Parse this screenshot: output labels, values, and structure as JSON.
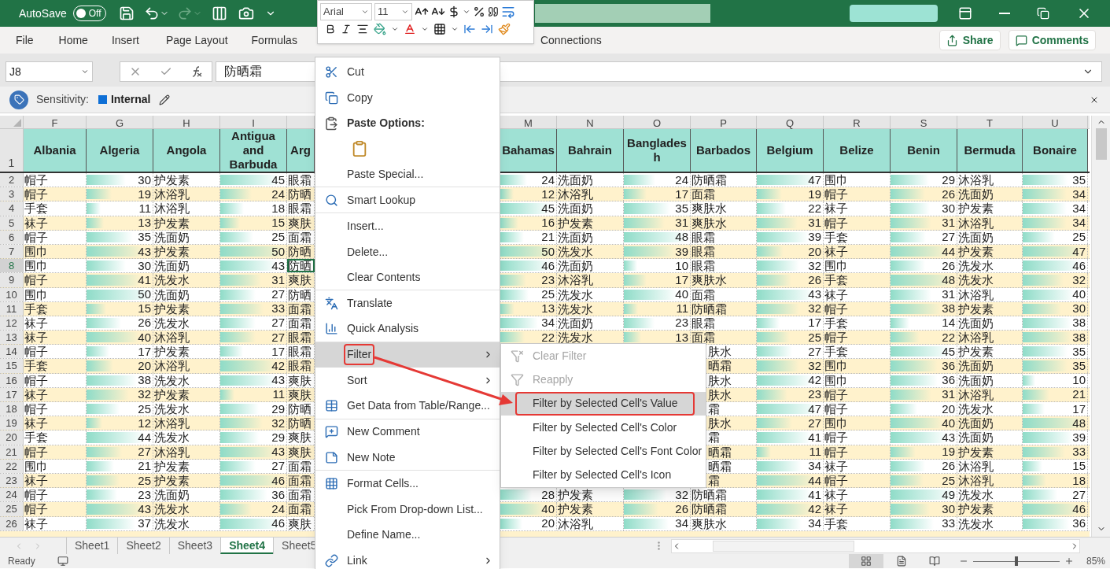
{
  "title_bar": {
    "autosave_label": "AutoSave",
    "autosave": {
      "on": false,
      "label": "Off"
    }
  },
  "mini_toolbar": {
    "font": "Arial",
    "size": "11"
  },
  "ribbon_tabs": [
    {
      "label": "File"
    },
    {
      "label": "Home"
    },
    {
      "label": "Insert"
    },
    {
      "label": "Page Layout"
    },
    {
      "label": "Formulas"
    },
    {
      "label": "Connections"
    }
  ],
  "share": "Share",
  "comments": "Comments",
  "formula_bar": {
    "name_box": "J8",
    "value": "防晒霜"
  },
  "sensitivity": {
    "label": "Sensitivity:",
    "value": "Internal"
  },
  "grid": {
    "header_row": "1",
    "left_columns": [
      {
        "letter": "F",
        "header": "Albania"
      },
      {
        "letter": "G",
        "header": "Algeria"
      },
      {
        "letter": "H",
        "header": "Angola"
      },
      {
        "letter": "I",
        "header": "Antigua and Barbuda"
      },
      {
        "header": "Arg"
      }
    ],
    "right_columns": [
      {
        "letter": "M",
        "header": "Bahamas"
      },
      {
        "letter": "N",
        "header": "Bahrain"
      },
      {
        "letter": "O",
        "header": "Bangladesh"
      },
      {
        "letter": "P",
        "header": "Barbados"
      },
      {
        "letter": "Q",
        "header": "Belgium"
      },
      {
        "letter": "R",
        "header": "Belize"
      },
      {
        "letter": "S",
        "header": "Benin"
      },
      {
        "letter": "T",
        "header": "Bermuda"
      },
      {
        "letter": "U",
        "header": "Bonaire"
      }
    ],
    "rows": [
      {
        "num": "2",
        "selected": false,
        "left": [
          "帽子",
          {
            "v": "30",
            "level": 0.6
          },
          "护发素",
          {
            "v": "45",
            "level": 0.9
          },
          "眼霜"
        ],
        "right": [
          {
            "v": "24",
            "level": 0.48
          },
          "洗面奶",
          {
            "v": "24",
            "level": 0.48
          },
          "防晒霜",
          {
            "v": "47",
            "level": 0.94
          },
          "围巾",
          {
            "v": "29",
            "level": 0.58
          },
          "沐浴乳",
          {
            "v": "35",
            "level": 0.7
          }
        ]
      },
      {
        "num": "3",
        "selected": false,
        "left": [
          "帽子",
          {
            "v": "19",
            "level": 0.38
          },
          "沐浴乳",
          {
            "v": "24",
            "level": 0.48
          },
          "防晒"
        ],
        "right": [
          {
            "v": "12",
            "level": 0.24
          },
          "沐浴乳",
          {
            "v": "17",
            "level": 0.34
          },
          "面霜",
          {
            "v": "19",
            "level": 0.38
          },
          "帽子",
          {
            "v": "26",
            "level": 0.52
          },
          "洗面奶",
          {
            "v": "34",
            "level": 0.68
          }
        ]
      },
      {
        "num": "4",
        "selected": false,
        "left": [
          "手套",
          {
            "v": "11",
            "level": 0.22
          },
          "沐浴乳",
          {
            "v": "18",
            "level": 0.36
          },
          "眼霜"
        ],
        "right": [
          {
            "v": "45",
            "level": 0.9
          },
          "洗面奶",
          {
            "v": "35",
            "level": 0.7
          },
          "爽肤水",
          {
            "v": "22",
            "level": 0.44
          },
          "袜子",
          {
            "v": "30",
            "level": 0.6
          },
          "护发素",
          {
            "v": "34",
            "level": 0.68
          }
        ]
      },
      {
        "num": "5",
        "selected": false,
        "left": [
          "袜子",
          {
            "v": "13",
            "level": 0.26
          },
          "护发素",
          {
            "v": "15",
            "level": 0.3
          },
          "爽肤"
        ],
        "right": [
          {
            "v": "16",
            "level": 0.32
          },
          "护发素",
          {
            "v": "31",
            "level": 0.62
          },
          "爽肤水",
          {
            "v": "31",
            "level": 0.62
          },
          "帽子",
          {
            "v": "31",
            "level": 0.62
          },
          "沐浴乳",
          {
            "v": "34",
            "level": 0.68
          }
        ]
      },
      {
        "num": "6",
        "selected": false,
        "left": [
          "帽子",
          {
            "v": "35",
            "level": 0.7
          },
          "洗面奶",
          {
            "v": "25",
            "level": 0.5
          },
          "面霜"
        ],
        "right": [
          {
            "v": "21",
            "level": 0.42
          },
          "洗面奶",
          {
            "v": "48",
            "level": 0.96
          },
          "眼霜",
          {
            "v": "39",
            "level": 0.78
          },
          "手套",
          {
            "v": "27",
            "level": 0.54
          },
          "洗面奶",
          {
            "v": "25",
            "level": 0.5
          }
        ]
      },
      {
        "num": "7",
        "selected": false,
        "left": [
          "围巾",
          {
            "v": "43",
            "level": 0.86
          },
          "护发素",
          {
            "v": "50",
            "level": 1
          },
          "防晒"
        ],
        "right": [
          {
            "v": "50",
            "level": 1
          },
          "洗发水",
          {
            "v": "39",
            "level": 0.78
          },
          "眼霜",
          {
            "v": "20",
            "level": 0.4
          },
          "袜子",
          {
            "v": "44",
            "level": 0.88
          },
          "护发素",
          {
            "v": "47",
            "level": 0.94
          }
        ]
      },
      {
        "num": "8",
        "selected": true,
        "left": [
          "围巾",
          {
            "v": "30",
            "level": 0.6
          },
          "洗面奶",
          {
            "v": "43",
            "level": 0.86
          },
          "防晒"
        ],
        "right": [
          {
            "v": "46",
            "level": 0.92
          },
          "洗面奶",
          {
            "v": "10",
            "level": 0.2
          },
          "眼霜",
          {
            "v": "32",
            "level": 0.64
          },
          "围巾",
          {
            "v": "26",
            "level": 0.52
          },
          "洗发水",
          {
            "v": "46",
            "level": 0.92
          }
        ]
      },
      {
        "num": "9",
        "selected": false,
        "left": [
          "帽子",
          {
            "v": "41",
            "level": 0.82
          },
          "洗发水",
          {
            "v": "31",
            "level": 0.62
          },
          "爽肤"
        ],
        "right": [
          {
            "v": "23",
            "level": 0.46
          },
          "沐浴乳",
          {
            "v": "17",
            "level": 0.34
          },
          "爽肤水",
          {
            "v": "26",
            "level": 0.52
          },
          "手套",
          {
            "v": "48",
            "level": 0.96
          },
          "洗发水",
          {
            "v": "32",
            "level": 0.64
          }
        ]
      },
      {
        "num": "10",
        "selected": false,
        "left": [
          "围巾",
          {
            "v": "50",
            "level": 1
          },
          "洗面奶",
          {
            "v": "27",
            "level": 0.54
          },
          "防晒"
        ],
        "right": [
          {
            "v": "25",
            "level": 0.5
          },
          "洗发水",
          {
            "v": "40",
            "level": 0.8
          },
          "面霜",
          {
            "v": "43",
            "level": 0.86
          },
          "袜子",
          {
            "v": "31",
            "level": 0.62
          },
          "沐浴乳",
          {
            "v": "40",
            "level": 0.8
          }
        ]
      },
      {
        "num": "11",
        "selected": false,
        "left": [
          "手套",
          {
            "v": "15",
            "level": 0.3
          },
          "护发素",
          {
            "v": "33",
            "level": 0.66
          },
          "面霜"
        ],
        "right": [
          {
            "v": "13",
            "level": 0.26
          },
          "洗发水",
          {
            "v": "11",
            "level": 0.22
          },
          "防晒霜",
          {
            "v": "32",
            "level": 0.64
          },
          "帽子",
          {
            "v": "38",
            "level": 0.76
          },
          "护发素",
          {
            "v": "30",
            "level": 0.6
          }
        ]
      },
      {
        "num": "12",
        "selected": false,
        "left": [
          "袜子",
          {
            "v": "26",
            "level": 0.52
          },
          "洗发水",
          {
            "v": "27",
            "level": 0.54
          },
          "面霜"
        ],
        "right": [
          {
            "v": "34",
            "level": 0.68
          },
          "洗面奶",
          {
            "v": "23",
            "level": 0.46
          },
          "眼霜",
          {
            "v": "17",
            "level": 0.34
          },
          "手套",
          {
            "v": "14",
            "level": 0.28
          },
          "洗面奶",
          {
            "v": "38",
            "level": 0.76
          }
        ]
      },
      {
        "num": "13",
        "selected": false,
        "left": [
          "袜子",
          {
            "v": "40",
            "level": 0.8
          },
          "沐浴乳",
          {
            "v": "27",
            "level": 0.54
          },
          "眼霜"
        ],
        "right": [
          {
            "v": "22",
            "level": 0.44
          },
          "洗发水",
          {
            "v": "13",
            "level": 0.26
          },
          "面霜",
          {
            "v": "25",
            "level": 0.5
          },
          "帽子",
          {
            "v": "22",
            "level": 0.44
          },
          "沐浴乳",
          {
            "v": "38",
            "level": 0.76
          }
        ]
      },
      {
        "num": "14",
        "selected": false,
        "left": [
          "帽子",
          {
            "v": "17",
            "level": 0.34
          },
          "护发素",
          {
            "v": "17",
            "level": 0.34
          },
          "眼霜"
        ],
        "right": [
          {
            "kind": "covered"
          },
          {
            "kind": "covered"
          },
          {
            "kind": "covered"
          },
          {
            "text": "肤水",
            "kind": "clipped"
          },
          {
            "v": "27",
            "level": 0.54
          },
          "手套",
          {
            "v": "45",
            "level": 0.9
          },
          "护发素",
          {
            "v": "35",
            "level": 0.7
          }
        ]
      },
      {
        "num": "15",
        "selected": false,
        "left": [
          "手套",
          {
            "v": "20",
            "level": 0.4
          },
          "沐浴乳",
          {
            "v": "42",
            "level": 0.84
          },
          "眼霜"
        ],
        "right": [
          {
            "kind": "covered"
          },
          {
            "kind": "covered"
          },
          {
            "kind": "covered"
          },
          {
            "text": "晒霜",
            "kind": "clipped"
          },
          {
            "v": "32",
            "level": 0.64
          },
          "围巾",
          {
            "v": "36",
            "level": 0.72
          },
          "洗面奶",
          {
            "v": "35",
            "level": 0.7
          }
        ]
      },
      {
        "num": "16",
        "selected": false,
        "left": [
          "帽子",
          {
            "v": "38",
            "level": 0.76
          },
          "洗发水",
          {
            "v": "43",
            "level": 0.86
          },
          "爽肤"
        ],
        "right": [
          {
            "kind": "covered"
          },
          {
            "kind": "covered"
          },
          {
            "kind": "covered"
          },
          {
            "text": "肤水",
            "kind": "clipped"
          },
          {
            "v": "42",
            "level": 0.84
          },
          "围巾",
          {
            "v": "36",
            "level": 0.72
          },
          "洗面奶",
          {
            "v": "10",
            "level": 0.2
          }
        ]
      },
      {
        "num": "17",
        "selected": false,
        "left": [
          "袜子",
          {
            "v": "32",
            "level": 0.64
          },
          "护发素",
          {
            "v": "11",
            "level": 0.22
          },
          "爽肤"
        ],
        "right": [
          {
            "kind": "covered"
          },
          {
            "kind": "covered"
          },
          {
            "kind": "covered"
          },
          {
            "text": "肤水",
            "kind": "clipped"
          },
          {
            "v": "23",
            "level": 0.46
          },
          "帽子",
          {
            "v": "31",
            "level": 0.62
          },
          "沐浴乳",
          {
            "v": "21",
            "level": 0.42
          }
        ]
      },
      {
        "num": "18",
        "selected": false,
        "left": [
          "帽子",
          {
            "v": "25",
            "level": 0.5
          },
          "洗发水",
          {
            "v": "29",
            "level": 0.58
          },
          "防晒"
        ],
        "right": [
          {
            "kind": "covered"
          },
          {
            "kind": "covered"
          },
          {
            "kind": "covered"
          },
          {
            "text": "霜",
            "kind": "clipped"
          },
          {
            "v": "47",
            "level": 0.94
          },
          "帽子",
          {
            "v": "20",
            "level": 0.4
          },
          "洗发水",
          {
            "v": "17",
            "level": 0.34
          }
        ]
      },
      {
        "num": "19",
        "selected": false,
        "left": [
          "袜子",
          {
            "v": "12",
            "level": 0.24
          },
          "沐浴乳",
          {
            "v": "32",
            "level": 0.64
          },
          "防晒"
        ],
        "right": [
          {
            "kind": "covered"
          },
          {
            "kind": "covered"
          },
          {
            "kind": "covered"
          },
          {
            "text": "肤水",
            "kind": "clipped"
          },
          {
            "v": "27",
            "level": 0.54
          },
          "围巾",
          {
            "v": "40",
            "level": 0.8
          },
          "洗面奶",
          {
            "v": "48",
            "level": 0.96
          }
        ]
      },
      {
        "num": "20",
        "selected": false,
        "left": [
          "手套",
          {
            "v": "44",
            "level": 0.88
          },
          "洗发水",
          {
            "v": "29",
            "level": 0.58
          },
          "爽肤"
        ],
        "right": [
          {
            "kind": "covered"
          },
          {
            "kind": "covered"
          },
          {
            "kind": "covered"
          },
          {
            "text": "霜",
            "kind": "clipped"
          },
          {
            "v": "41",
            "level": 0.82
          },
          "帽子",
          {
            "v": "43",
            "level": 0.86
          },
          "洗面奶",
          {
            "v": "39",
            "level": 0.78
          }
        ]
      },
      {
        "num": "21",
        "selected": false,
        "left": [
          "帽子",
          {
            "v": "27",
            "level": 0.54
          },
          "沐浴乳",
          {
            "v": "43",
            "level": 0.86
          },
          "爽肤"
        ],
        "right": [
          {
            "kind": "covered"
          },
          {
            "kind": "covered"
          },
          {
            "kind": "covered"
          },
          {
            "text": "晒霜",
            "kind": "clipped"
          },
          {
            "v": "11",
            "level": 0.22
          },
          "帽子",
          {
            "v": "19",
            "level": 0.38
          },
          "护发素",
          {
            "v": "33",
            "level": 0.66
          }
        ]
      },
      {
        "num": "22",
        "selected": false,
        "left": [
          "围巾",
          {
            "v": "21",
            "level": 0.42
          },
          "护发素",
          {
            "v": "27",
            "level": 0.54
          },
          "面霜"
        ],
        "right": [
          {
            "kind": "covered"
          },
          {
            "kind": "covered"
          },
          {
            "kind": "covered"
          },
          {
            "text": "晒霜",
            "kind": "clipped"
          },
          {
            "v": "34",
            "level": 0.68
          },
          "袜子",
          {
            "v": "26",
            "level": 0.52
          },
          "沐浴乳",
          {
            "v": "15",
            "level": 0.3
          }
        ]
      },
      {
        "num": "23",
        "selected": false,
        "left": [
          "袜子",
          {
            "v": "25",
            "level": 0.5
          },
          "护发素",
          {
            "v": "46",
            "level": 0.92
          },
          "面霜"
        ],
        "right": [
          {
            "kind": "covered"
          },
          {
            "kind": "covered"
          },
          {
            "kind": "covered"
          },
          {
            "text": "霜",
            "kind": "clipped"
          },
          {
            "v": "44",
            "level": 0.88
          },
          "帽子",
          {
            "v": "25",
            "level": 0.5
          },
          "沐浴乳",
          {
            "v": "18",
            "level": 0.36
          }
        ]
      },
      {
        "num": "24",
        "selected": false,
        "left": [
          "帽子",
          {
            "v": "23",
            "level": 0.46
          },
          "洗面奶",
          {
            "v": "36",
            "level": 0.72
          },
          "面霜"
        ],
        "right": [
          {
            "v": "28",
            "level": 0.56
          },
          "护发素",
          {
            "v": "32",
            "level": 0.64
          },
          "防晒霜",
          {
            "v": "41",
            "level": 0.82
          },
          "袜子",
          {
            "v": "49",
            "level": 0.98
          },
          "洗发水",
          {
            "v": "27",
            "level": 0.54
          }
        ]
      },
      {
        "num": "25",
        "selected": false,
        "left": [
          "帽子",
          {
            "v": "43",
            "level": 0.86
          },
          "洗发水",
          {
            "v": "24",
            "level": 0.48
          },
          "面霜"
        ],
        "right": [
          {
            "v": "40",
            "level": 0.8
          },
          "护发素",
          {
            "v": "26",
            "level": 0.52
          },
          "防晒霜",
          {
            "v": "42",
            "level": 0.84
          },
          "袜子",
          {
            "v": "30",
            "level": 0.6
          },
          "护发素",
          {
            "v": "46",
            "level": 0.92
          }
        ]
      },
      {
        "num": "26",
        "selected": false,
        "left": [
          "袜子",
          {
            "v": "37",
            "level": 0.74
          },
          "洗发水",
          {
            "v": "46",
            "level": 0.92
          },
          "爽肤"
        ],
        "right": [
          {
            "v": "20",
            "level": 0.4
          },
          "沐浴乳",
          {
            "v": "34",
            "level": 0.68
          },
          "爽肤水",
          {
            "v": "34",
            "level": 0.68
          },
          "手套",
          {
            "v": "33",
            "level": 0.66
          },
          "洗发水",
          {
            "v": "36",
            "level": 0.72
          }
        ]
      }
    ]
  },
  "sheet_tabs": [
    {
      "label": "Sheet1",
      "selected": false
    },
    {
      "label": "Sheet2",
      "selected": false
    },
    {
      "label": "Sheet3",
      "selected": false
    },
    {
      "label": "Sheet4",
      "selected": true
    },
    {
      "label": "Sheet5",
      "selected": false
    }
  ],
  "status_bar": {
    "text": "Ready",
    "zoom": {
      "level": 0.48,
      "label": "85%"
    }
  },
  "context_menu": [
    {
      "kind": "item",
      "label": "Cut",
      "selected": false,
      "submenu": false,
      "annotated": false
    },
    {
      "kind": "item",
      "label": "Copy",
      "selected": false,
      "submenu": false,
      "annotated": false
    },
    {
      "kind": "header",
      "label": "Paste Options:"
    },
    {
      "kind": "paste_icon"
    },
    {
      "kind": "item",
      "label": "Paste Special...",
      "selected": false,
      "submenu": false,
      "annotated": false
    },
    {
      "kind": "item",
      "label": "Smart Lookup",
      "selected": false,
      "submenu": false,
      "annotated": false
    },
    {
      "kind": "item",
      "label": "Insert...",
      "selected": false,
      "submenu": false,
      "annotated": false
    },
    {
      "kind": "item",
      "label": "Delete...",
      "selected": false,
      "submenu": false,
      "annotated": false
    },
    {
      "kind": "item",
      "label": "Clear Contents",
      "selected": false,
      "submenu": false,
      "annotated": false
    },
    {
      "kind": "item",
      "label": "Translate",
      "selected": false,
      "submenu": false,
      "annotated": false
    },
    {
      "kind": "item",
      "label": "Quick Analysis",
      "selected": false,
      "submenu": false,
      "annotated": false
    },
    {
      "kind": "item",
      "label": "Filter",
      "selected": true,
      "submenu": true,
      "annotated": true
    },
    {
      "kind": "item",
      "label": "Sort",
      "selected": false,
      "submenu": true,
      "annotated": false
    },
    {
      "kind": "item",
      "label": "Get Data from Table/Range...",
      "selected": false,
      "submenu": false,
      "annotated": false
    },
    {
      "kind": "item",
      "label": "New Comment",
      "selected": false,
      "submenu": false,
      "annotated": false
    },
    {
      "kind": "item",
      "label": "New Note",
      "selected": false,
      "submenu": false,
      "annotated": false
    },
    {
      "kind": "item",
      "label": "Format Cells...",
      "selected": false,
      "submenu": false,
      "annotated": false
    },
    {
      "kind": "item",
      "label": "Pick From Drop-down List...",
      "selected": false,
      "submenu": false,
      "annotated": false
    },
    {
      "kind": "item",
      "label": "Define Name...",
      "selected": false,
      "submenu": false,
      "annotated": false
    },
    {
      "kind": "item",
      "label": "Link",
      "selected": false,
      "submenu": true,
      "annotated": false
    }
  ],
  "filter_submenu": [
    {
      "label": "Clear Filter",
      "disabled": true,
      "selected": false,
      "annotated": false
    },
    {
      "label": "Reapply",
      "disabled": true,
      "selected": false,
      "annotated": false
    },
    {
      "label": "Filter by Selected Cell's Value",
      "disabled": false,
      "selected": true,
      "annotated": true
    },
    {
      "label": "Filter by Selected Cell's Color",
      "disabled": false,
      "selected": false,
      "annotated": false
    },
    {
      "label": "Filter by Selected Cell's Font Color",
      "disabled": false,
      "selected": false,
      "annotated": false
    },
    {
      "label": "Filter by Selected Cell's Icon",
      "disabled": false,
      "selected": false,
      "annotated": false
    }
  ]
}
